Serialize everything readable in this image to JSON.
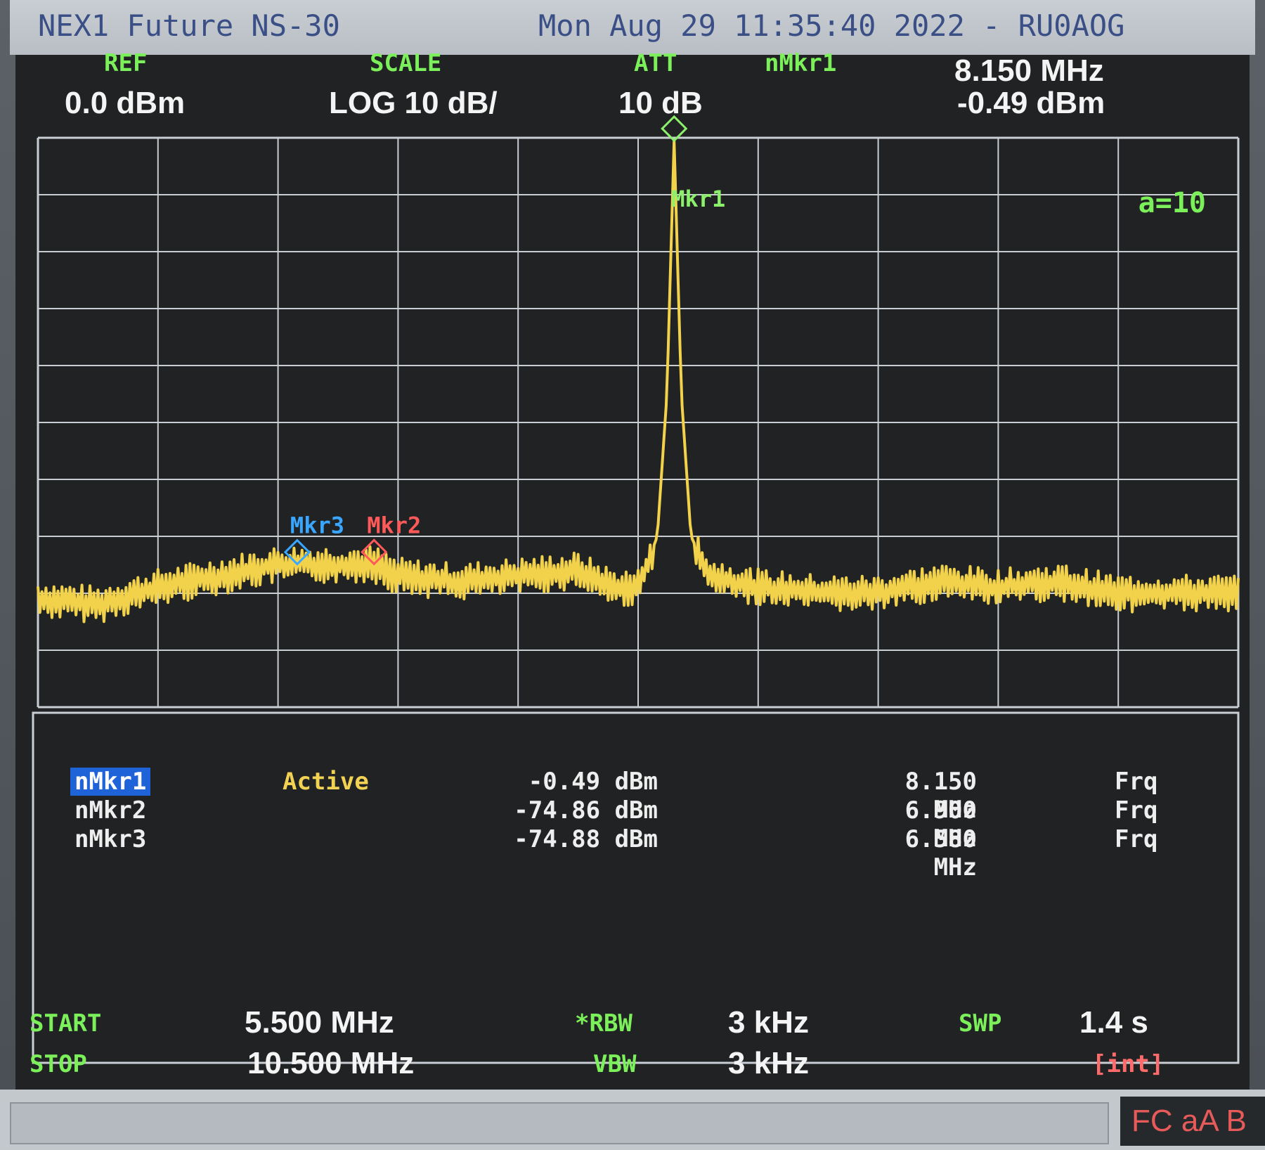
{
  "instrument": {
    "title": "NEX1 Future NS-30",
    "timestamp": "Mon Aug 29 11:35:40 2022 - RU0AOG"
  },
  "header": {
    "ref_label": "REF",
    "ref_value": "0.0 dBm",
    "scale_label": "SCALE",
    "scale_value": "LOG 10 dB/",
    "att_label": "ATT",
    "att_value": "10 dB",
    "active_marker_label": "nMkr1",
    "active_marker_freq": "8.150 MHz",
    "active_marker_amp": "-0.49 dBm"
  },
  "plot": {
    "avg_label": "a=10",
    "markers": [
      {
        "label": "Mkr1",
        "color": "#8df06a",
        "freq_mhz": 8.15,
        "amp_dbm": -0.49
      },
      {
        "label": "Mkr2",
        "color": "#ff5a5a",
        "freq_mhz": 6.9,
        "amp_dbm": -74.86
      },
      {
        "label": "Mkr3",
        "color": "#39a7ff",
        "freq_mhz": 6.58,
        "amp_dbm": -74.88
      }
    ]
  },
  "marker_table": [
    {
      "name": "nMkr1",
      "state": "Active",
      "amp": "-0.49 dBm",
      "freq": "8.150 MHz",
      "mode": "Frq"
    },
    {
      "name": "nMkr2",
      "state": "",
      "amp": "-74.86 dBm",
      "freq": "6.900 MHz",
      "mode": "Frq"
    },
    {
      "name": "nMkr3",
      "state": "",
      "amp": "-74.88 dBm",
      "freq": "6.580 MHz",
      "mode": "Frq"
    }
  ],
  "footer": {
    "start_label": "START",
    "start_value": "5.500 MHz",
    "stop_label": "STOP",
    "stop_value": "10.500 MHz",
    "rbw_label": "*RBW",
    "rbw_value": "3 kHz",
    "vbw_label": "VBW",
    "vbw_value": "3 kHz",
    "swp_label": "SWP",
    "swp_value": "1.4 s",
    "swp_mode": "[int]"
  },
  "status_bar": {
    "mode_indicators": "FC aA B"
  },
  "colors": {
    "trace": "#f2d24a",
    "grid": "#c8ced4",
    "label_green": "#7cf05a"
  },
  "chart_data": {
    "type": "line",
    "title": "",
    "xlabel": "",
    "ylabel": "",
    "x_unit": "MHz",
    "y_unit": "dBm",
    "xlim": [
      5.5,
      10.5
    ],
    "ylim": [
      -100,
      0
    ],
    "grid": true,
    "x": [
      5.5,
      5.75,
      6.0,
      6.25,
      6.5,
      6.58,
      6.75,
      6.9,
      7.0,
      7.25,
      7.5,
      7.75,
      7.9,
      8.0,
      8.08,
      8.12,
      8.15,
      8.18,
      8.22,
      8.3,
      8.5,
      8.75,
      9.0,
      9.25,
      9.5,
      9.75,
      10.0,
      10.25,
      10.5
    ],
    "series": [
      {
        "values": [
          -81,
          -82,
          -79,
          -77,
          -75,
          -74.9,
          -75,
          -74.9,
          -77,
          -78,
          -77,
          -76,
          -79,
          -79,
          -70,
          -45,
          -0.5,
          -45,
          -70,
          -77,
          -79,
          -80,
          -80,
          -78,
          -79,
          -78,
          -80,
          -80,
          -80
        ]
      }
    ]
  }
}
